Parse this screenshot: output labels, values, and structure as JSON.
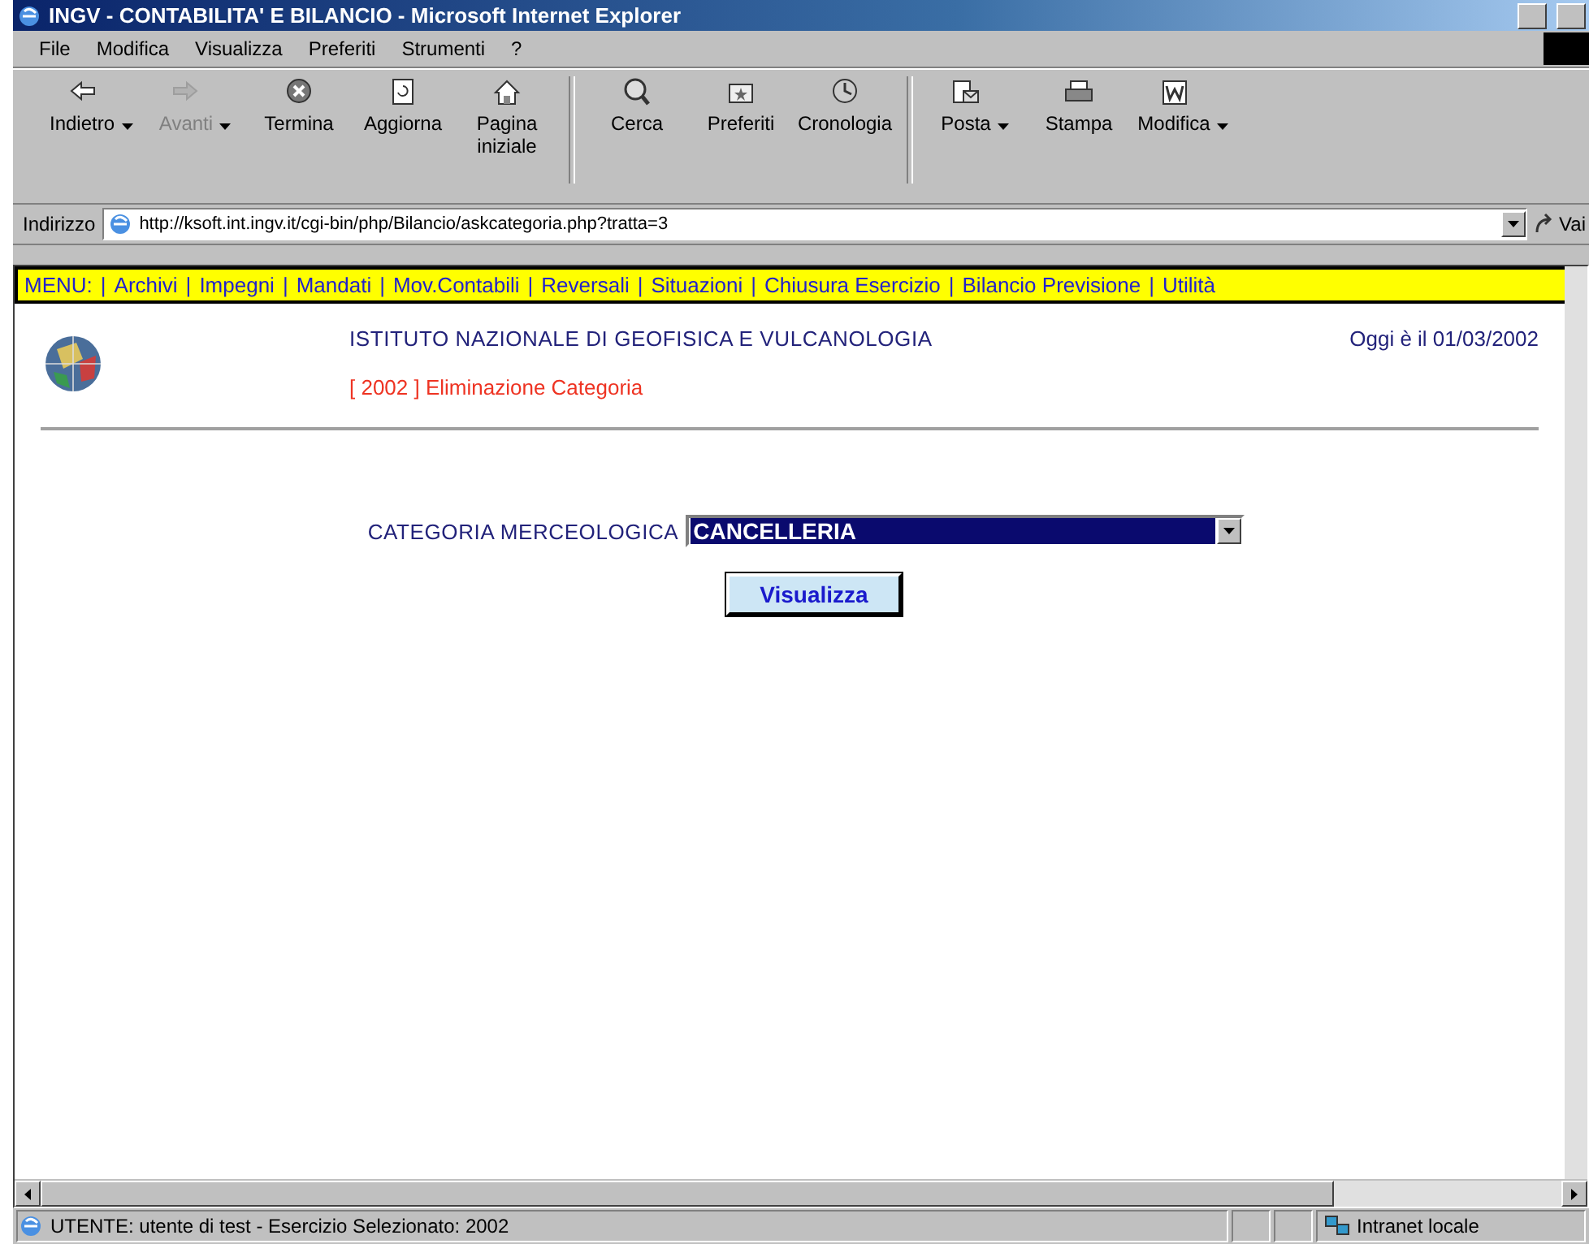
{
  "window": {
    "title": "INGV - CONTABILITA' E BILANCIO - Microsoft Internet Explorer"
  },
  "menu_bar": [
    "File",
    "Modifica",
    "Visualizza",
    "Preferiti",
    "Strumenti",
    "?"
  ],
  "toolbar": [
    {
      "label": "Indietro",
      "disabled": false,
      "dropdown": true
    },
    {
      "label": "Avanti",
      "disabled": true,
      "dropdown": true
    },
    {
      "label": "Termina",
      "disabled": false,
      "dropdown": false
    },
    {
      "label": "Aggiorna",
      "disabled": false,
      "dropdown": false
    },
    {
      "label": "Pagina iniziale",
      "disabled": false,
      "dropdown": false
    },
    {
      "label": "Cerca",
      "disabled": false,
      "dropdown": false
    },
    {
      "label": "Preferiti",
      "disabled": false,
      "dropdown": false
    },
    {
      "label": "Cronologia",
      "disabled": false,
      "dropdown": false
    },
    {
      "label": "Posta",
      "disabled": false,
      "dropdown": true
    },
    {
      "label": "Stampa",
      "disabled": false,
      "dropdown": false
    },
    {
      "label": "Modifica",
      "disabled": false,
      "dropdown": true
    }
  ],
  "address_bar": {
    "label": "Indirizzo",
    "value": "http://ksoft.int.ingv.it/cgi-bin/php/Bilancio/askcategoria.php?tratta=3",
    "go": "Vai"
  },
  "site_menu": {
    "label": "MENU:",
    "items": [
      {
        "sep": "|",
        "label": "Archivi"
      },
      {
        "sep": "|",
        "label": "Impegni"
      },
      {
        "sep": "|",
        "label": "Mandati"
      },
      {
        "sep": "|",
        "label": "Mov.Contabili"
      },
      {
        "sep": "|",
        "label": "Reversali"
      },
      {
        "sep": "|",
        "label": "Situazioni"
      },
      {
        "sep": "|",
        "label": "Chiusura Esercizio"
      },
      {
        "sep": "|",
        "label": "Bilancio Previsione"
      },
      {
        "sep": "|",
        "label": "Utilità"
      }
    ]
  },
  "header": {
    "institute": "ISTITUTO NAZIONALE DI GEOFISICA E VULCANOLOGIA",
    "date": "Oggi è il 01/03/2002",
    "subtitle": "[ 2002 ] Eliminazione Categoria"
  },
  "form": {
    "label": "CATEGORIA MERCEOLOGICA",
    "select_value": "CANCELLERIA",
    "button": "Visualizza"
  },
  "status_bar": {
    "text": "UTENTE: utente di test  -  Esercizio Selezionato: 2002",
    "zone": "Intranet locale"
  }
}
